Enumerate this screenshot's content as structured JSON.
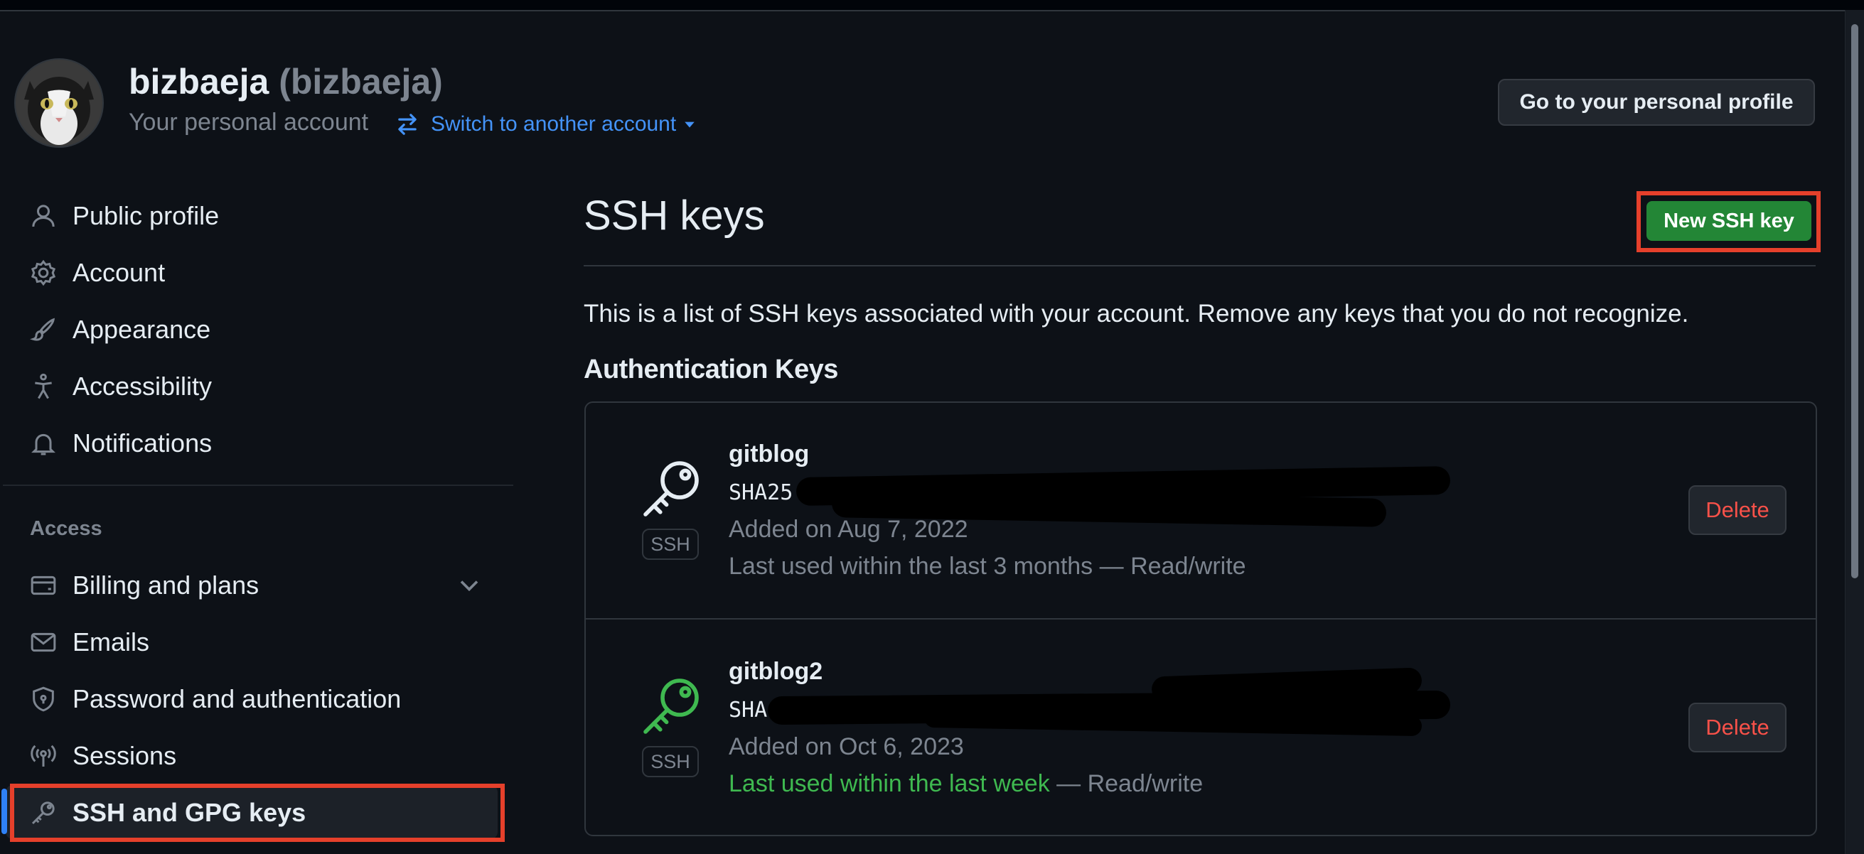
{
  "header": {
    "display_name": "bizbaeja",
    "login": "(bizbaeja)",
    "subtitle": "Your personal account",
    "switch_label": "Switch to another account",
    "profile_button": "Go to your personal profile"
  },
  "sidebar": {
    "items": [
      {
        "label": "Public profile",
        "icon": "person-icon"
      },
      {
        "label": "Account",
        "icon": "gear-icon"
      },
      {
        "label": "Appearance",
        "icon": "paintbrush-icon"
      },
      {
        "label": "Accessibility",
        "icon": "accessibility-icon"
      },
      {
        "label": "Notifications",
        "icon": "bell-icon"
      }
    ],
    "access_heading": "Access",
    "access_items": [
      {
        "label": "Billing and plans",
        "icon": "credit-card-icon"
      },
      {
        "label": "Emails",
        "icon": "mail-icon"
      },
      {
        "label": "Password and authentication",
        "icon": "shield-lock-icon"
      },
      {
        "label": "Sessions",
        "icon": "broadcast-icon"
      },
      {
        "label": "SSH and GPG keys",
        "icon": "key-icon",
        "active": true
      }
    ]
  },
  "main": {
    "title": "SSH keys",
    "new_key_button": "New SSH key",
    "description": "This is a list of SSH keys associated with your account. Remove any keys that you do not recognize.",
    "auth_heading": "Authentication Keys",
    "keys": [
      {
        "name": "gitblog",
        "fingerprint": "SHA25",
        "added": "Added on Aug 7, 2022",
        "last_used": "Last used within the last 3 months",
        "last_used_suffix": " — Read/write",
        "badge": "SSH",
        "delete_label": "Delete",
        "icon_color": "#e6edf3"
      },
      {
        "name": "gitblog2",
        "fingerprint": "SHA",
        "added": "Added on Oct 6, 2023",
        "last_used": "Last used within the last week",
        "last_used_suffix": " — Read/write",
        "badge": "SSH",
        "delete_label": "Delete",
        "icon_color": "#3fb950"
      }
    ]
  },
  "colors": {
    "background": "#0d1117",
    "primary_button": "#238636",
    "link": "#4493f8",
    "danger": "#f85149",
    "highlight_annotation": "#e5402b"
  }
}
